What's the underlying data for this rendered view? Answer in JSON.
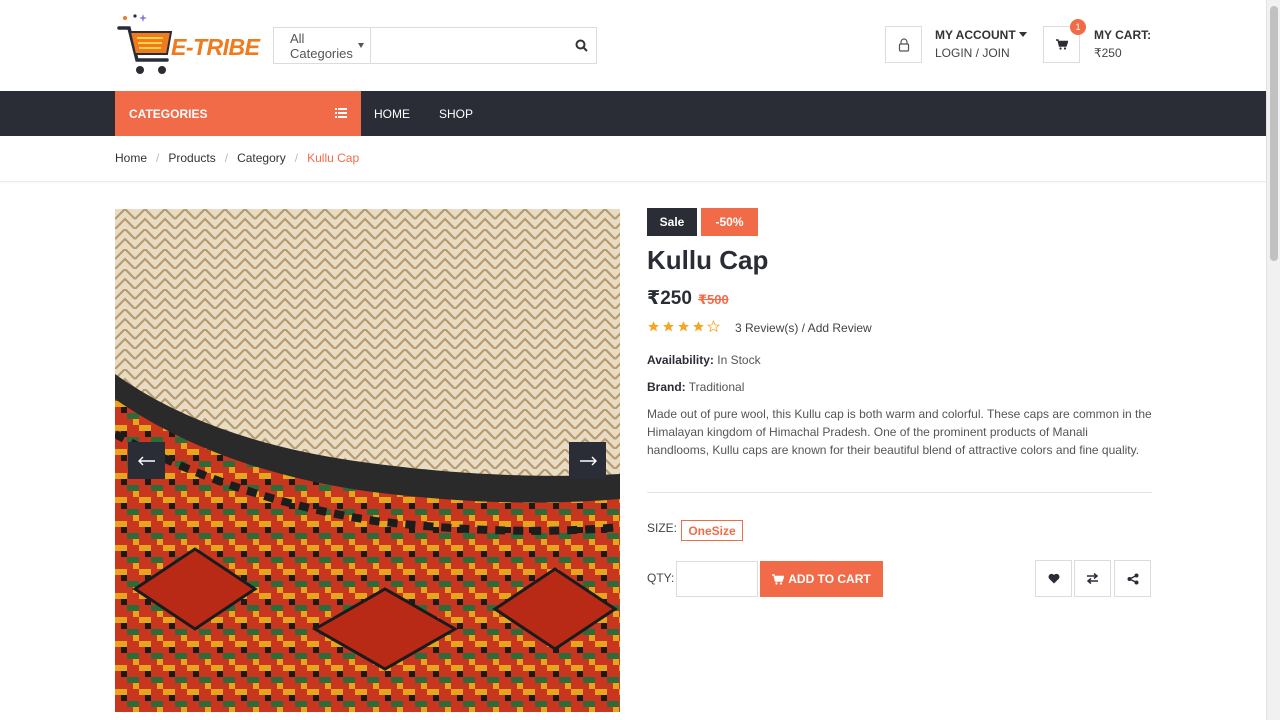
{
  "header": {
    "logo_text": "E-TRIBE",
    "search": {
      "category_label": "All Categories",
      "placeholder": "",
      "value": ""
    },
    "account": {
      "title": "MY ACCOUNT",
      "subtitle": "LOGIN / JOIN"
    },
    "cart": {
      "title": "MY CART:",
      "amount": "₹250",
      "count": "1"
    }
  },
  "nav": {
    "categories_label": "CATEGORIES",
    "links": [
      {
        "label": "HOME"
      },
      {
        "label": "SHOP"
      }
    ]
  },
  "breadcrumb": {
    "items": [
      {
        "label": "Home"
      },
      {
        "label": "Products"
      },
      {
        "label": "Category"
      }
    ],
    "current": "Kullu Cap"
  },
  "product": {
    "badge_sale": "Sale",
    "badge_discount": "-50%",
    "title": "Kullu Cap",
    "price": "₹250",
    "old_price": "₹500",
    "rating": {
      "value": 4,
      "max": 5
    },
    "reviews_text": "3 Review(s) / Add Review",
    "availability_label": "Availability:",
    "availability_value": " In Stock",
    "brand_label": "Brand:",
    "brand_value": " Traditional",
    "description": "Made out of pure wool, this Kullu cap is both warm and colorful. These caps are common in the Himalayan kingdom of Himachal Pradesh. One of the prominent products of Manali handlooms, Kullu caps are known for their beautiful blend of attractive colors and fine quality.",
    "size_label": "SIZE:",
    "size_option": "OneSize",
    "qty_label": "QTY:",
    "qty_value": "",
    "add_to_cart_label": "ADD TO CART"
  },
  "colors": {
    "accent": "#f26b49",
    "dark": "#2b2d36",
    "star": "#f5a623"
  },
  "icons": [
    "user-icon",
    "cart-icon",
    "search-icon",
    "list-icon",
    "arrow-left-icon",
    "arrow-right-icon",
    "heart-icon",
    "compare-icon",
    "share-icon",
    "star-icon"
  ]
}
